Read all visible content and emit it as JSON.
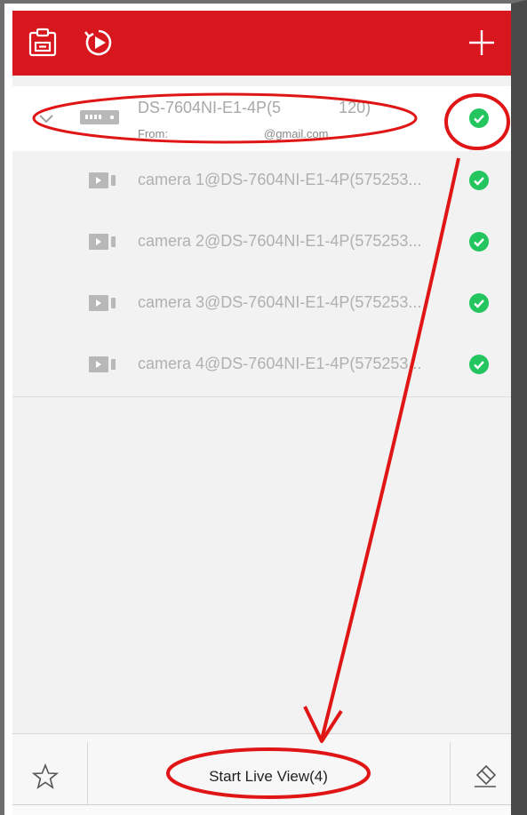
{
  "colors": {
    "topbar": "#d7161e",
    "status_online": "#22c55e",
    "annotation": "#e01616"
  },
  "topbar": {
    "icons": [
      "clipboard-icon",
      "playback-icon",
      "add-icon"
    ]
  },
  "device": {
    "name": "DS-7604NI-E1-4P(5             120)",
    "from_label": "From:",
    "email": "@gmail.com",
    "status": "online"
  },
  "cameras": [
    {
      "label": "camera 1@DS-7604NI-E1-4P(575253...",
      "status": "online"
    },
    {
      "label": "camera 2@DS-7604NI-E1-4P(575253...",
      "status": "online"
    },
    {
      "label": "camera 3@DS-7604NI-E1-4P(575253...",
      "status": "online"
    },
    {
      "label": "camera 4@DS-7604NI-E1-4P(575253...",
      "status": "online"
    }
  ],
  "bottombar": {
    "start_live_view": "Start Live View(4)",
    "icons": [
      "star-icon",
      "eraser-icon"
    ]
  }
}
